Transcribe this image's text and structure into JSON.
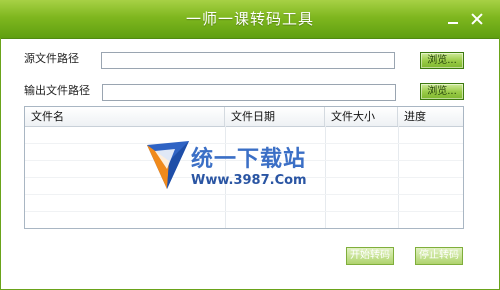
{
  "window": {
    "title": "一师一课转码工具"
  },
  "form": {
    "source_label": "源文件路径",
    "source_value": "",
    "output_label": "输出文件路径",
    "output_value": "",
    "browse_label_1": "浏览...",
    "browse_label_2": "浏览..."
  },
  "table": {
    "headers": [
      "文件名",
      "文件日期",
      "文件大小",
      "进度"
    ]
  },
  "watermark": {
    "main": "统一下载站",
    "url": "Www.3987.Com"
  },
  "actions": {
    "start": "开始转码",
    "stop": "停止转码"
  },
  "colors": {
    "titlebar": "#7fb71f",
    "accent": "#3d7a10",
    "watermark": "#3b6fc6"
  }
}
